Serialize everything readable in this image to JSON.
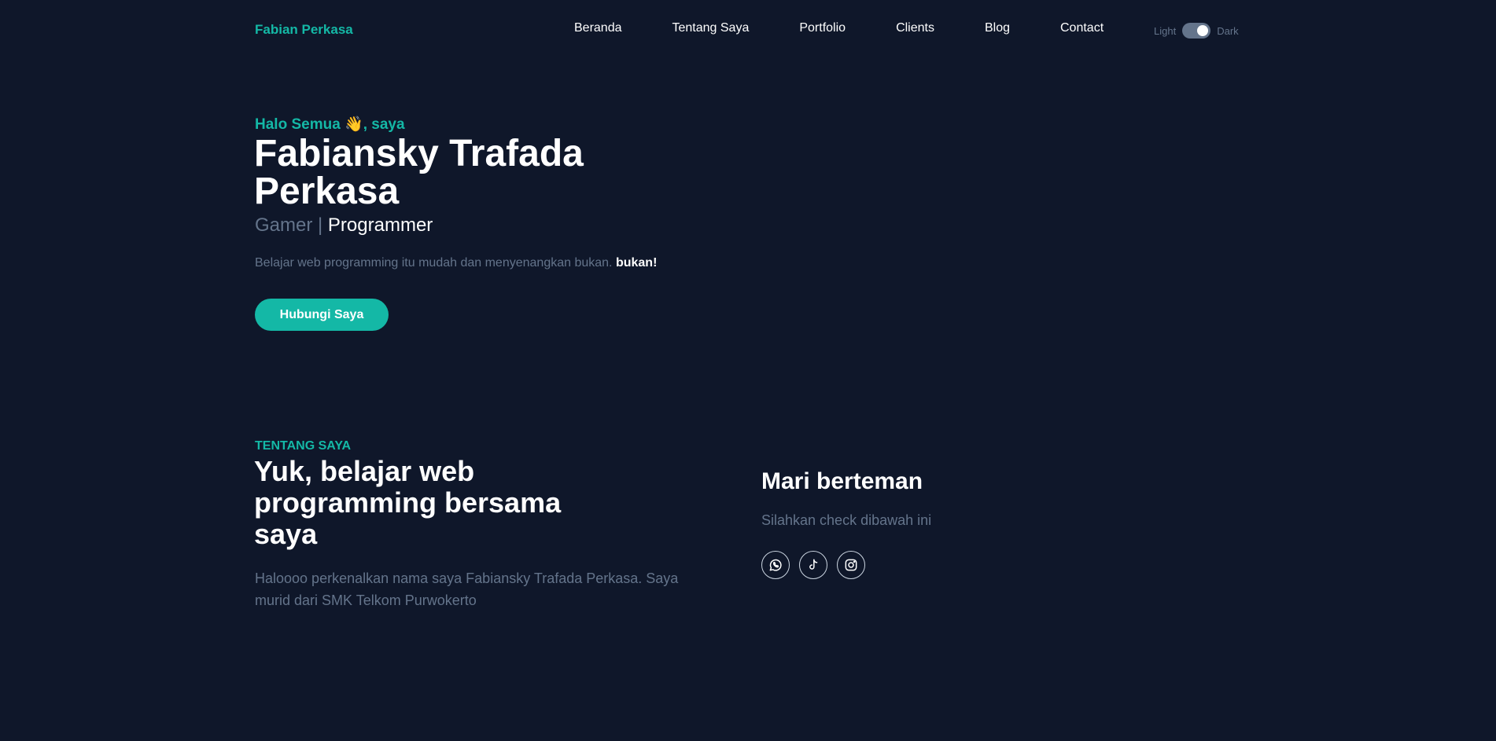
{
  "header": {
    "brand": "Fabian Perkasa",
    "nav": [
      "Beranda",
      "Tentang Saya",
      "Portfolio",
      "Clients",
      "Blog",
      "Contact"
    ],
    "theme_light_label": "Light",
    "theme_dark_label": "Dark"
  },
  "hero": {
    "greeting": "Halo Semua 👋, saya",
    "name": "Fabiansky Trafada Perkasa",
    "role_prefix": "Gamer | ",
    "role_accent": "Programmer",
    "description": "Belajar web programming itu mudah dan menyenangkan bukan. ",
    "description_bold": "bukan!",
    "cta_label": "Hubungi Saya"
  },
  "about": {
    "tag": "TENTANG SAYA",
    "title": "Yuk, belajar web programming bersama saya",
    "description": "Haloooo perkenalkan nama saya Fabiansky Trafada Perkasa. Saya murid dari SMK Telkom Purwokerto"
  },
  "friends": {
    "title": "Mari berteman",
    "description": "Silahkan check dibawah ini",
    "socials": [
      "whatsapp-icon",
      "tiktok-icon",
      "instagram-icon"
    ]
  },
  "colors": {
    "background": "#0f172a",
    "accent": "#14b8a6",
    "muted": "#64748b",
    "text": "#ffffff"
  }
}
